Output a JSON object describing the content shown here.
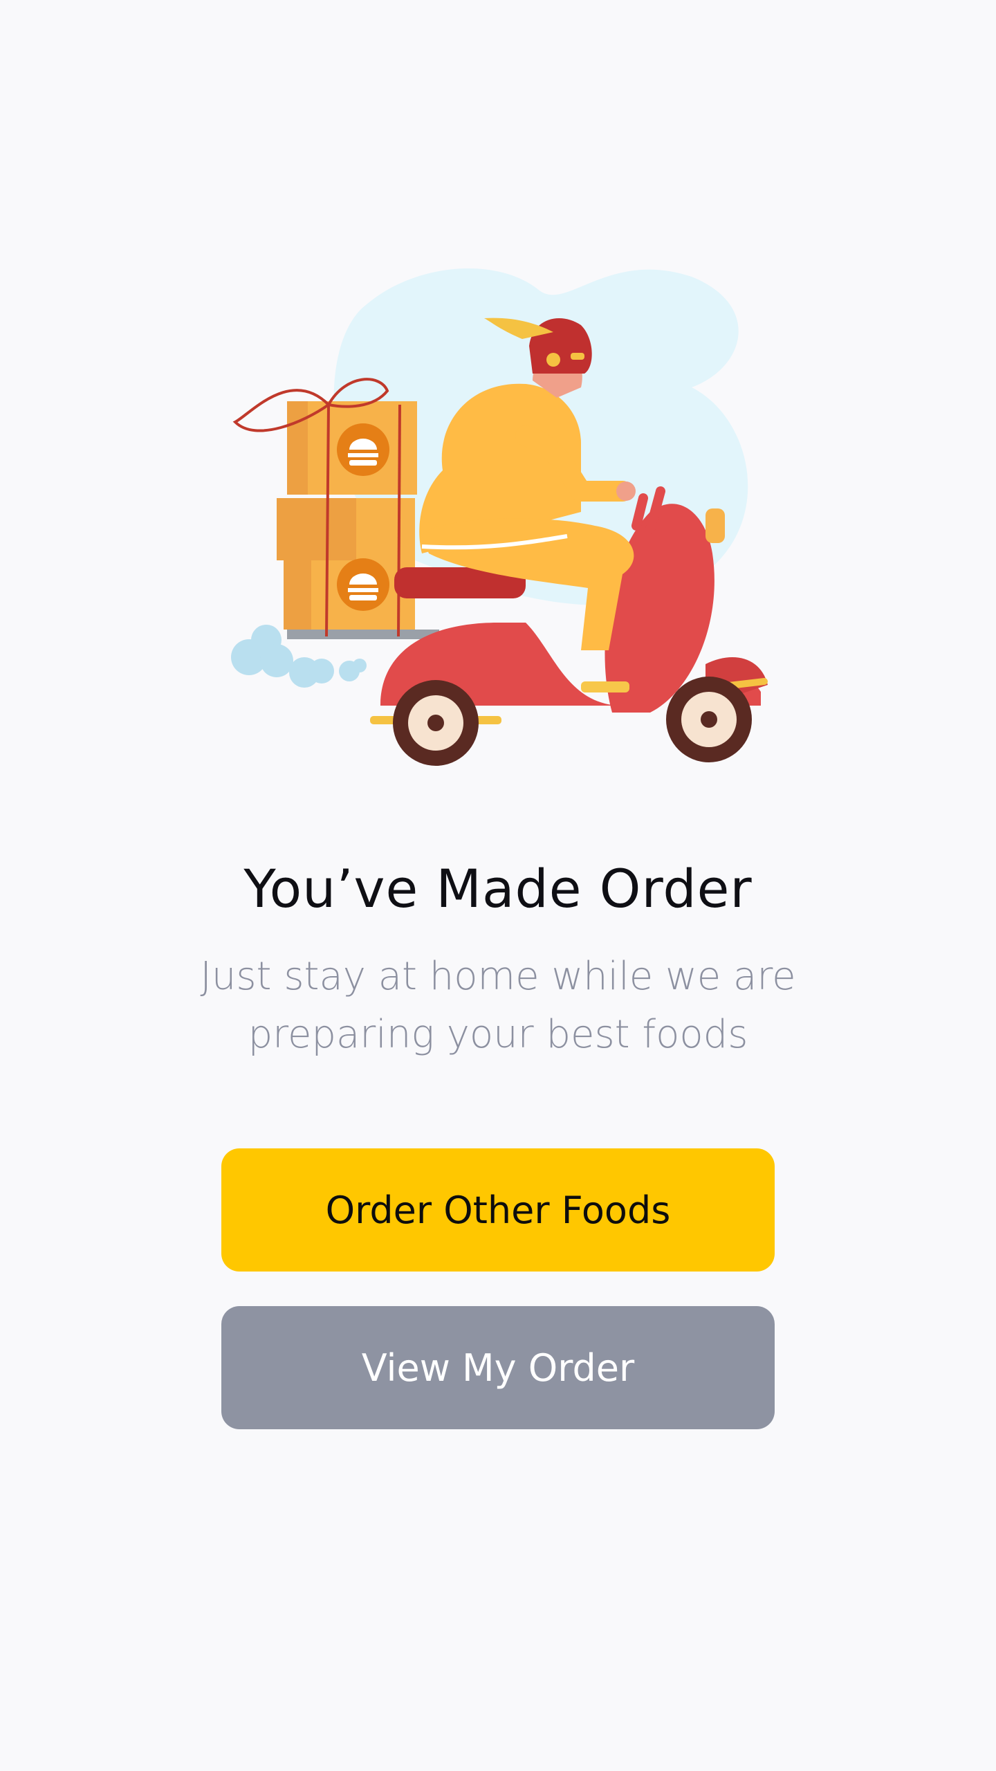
{
  "screen": {
    "title": "You’ve Made Order",
    "subtitle_line1": "Just stay at home while we are",
    "subtitle_line2": "preparing your best foods"
  },
  "buttons": {
    "primary_label": "Order Other Foods",
    "secondary_label": "View My Order"
  },
  "illustration": {
    "name": "delivery-scooter-illustration"
  },
  "colors": {
    "background": "#F9F9FB",
    "primary": "#FFC700",
    "secondary": "#8E93A2",
    "title": "#0F0F14",
    "subtitle": "#8C90A0"
  }
}
